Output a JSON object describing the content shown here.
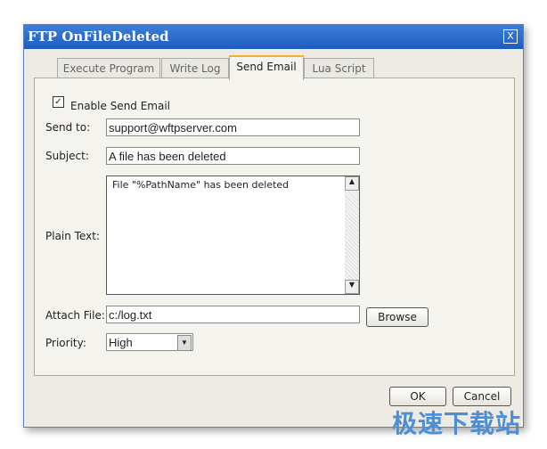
{
  "dialog": {
    "title": "FTP OnFileDeleted",
    "close": "X"
  },
  "tabs": [
    {
      "label": "Execute Program"
    },
    {
      "label": "Write Log"
    },
    {
      "label": "Send Email",
      "active": true
    },
    {
      "label": "Lua Script"
    }
  ],
  "form": {
    "enable_label": "Enable Send Email",
    "enable_checked": true,
    "checkmark": "✓",
    "send_to_label": "Send to:",
    "send_to": "support@wftpserver.com",
    "subject_label": "Subject:",
    "subject": "A file has been deleted",
    "plain_text_label": "Plain Text:",
    "plain_text": "File \"%PathName\" has been deleted",
    "attach_label": "Attach File:",
    "attach": "c:/log.txt",
    "browse": "Browse",
    "priority_label": "Priority:",
    "priority": "High"
  },
  "buttons": {
    "ok": "OK",
    "cancel": "Cancel"
  },
  "watermark": "极速下载站"
}
